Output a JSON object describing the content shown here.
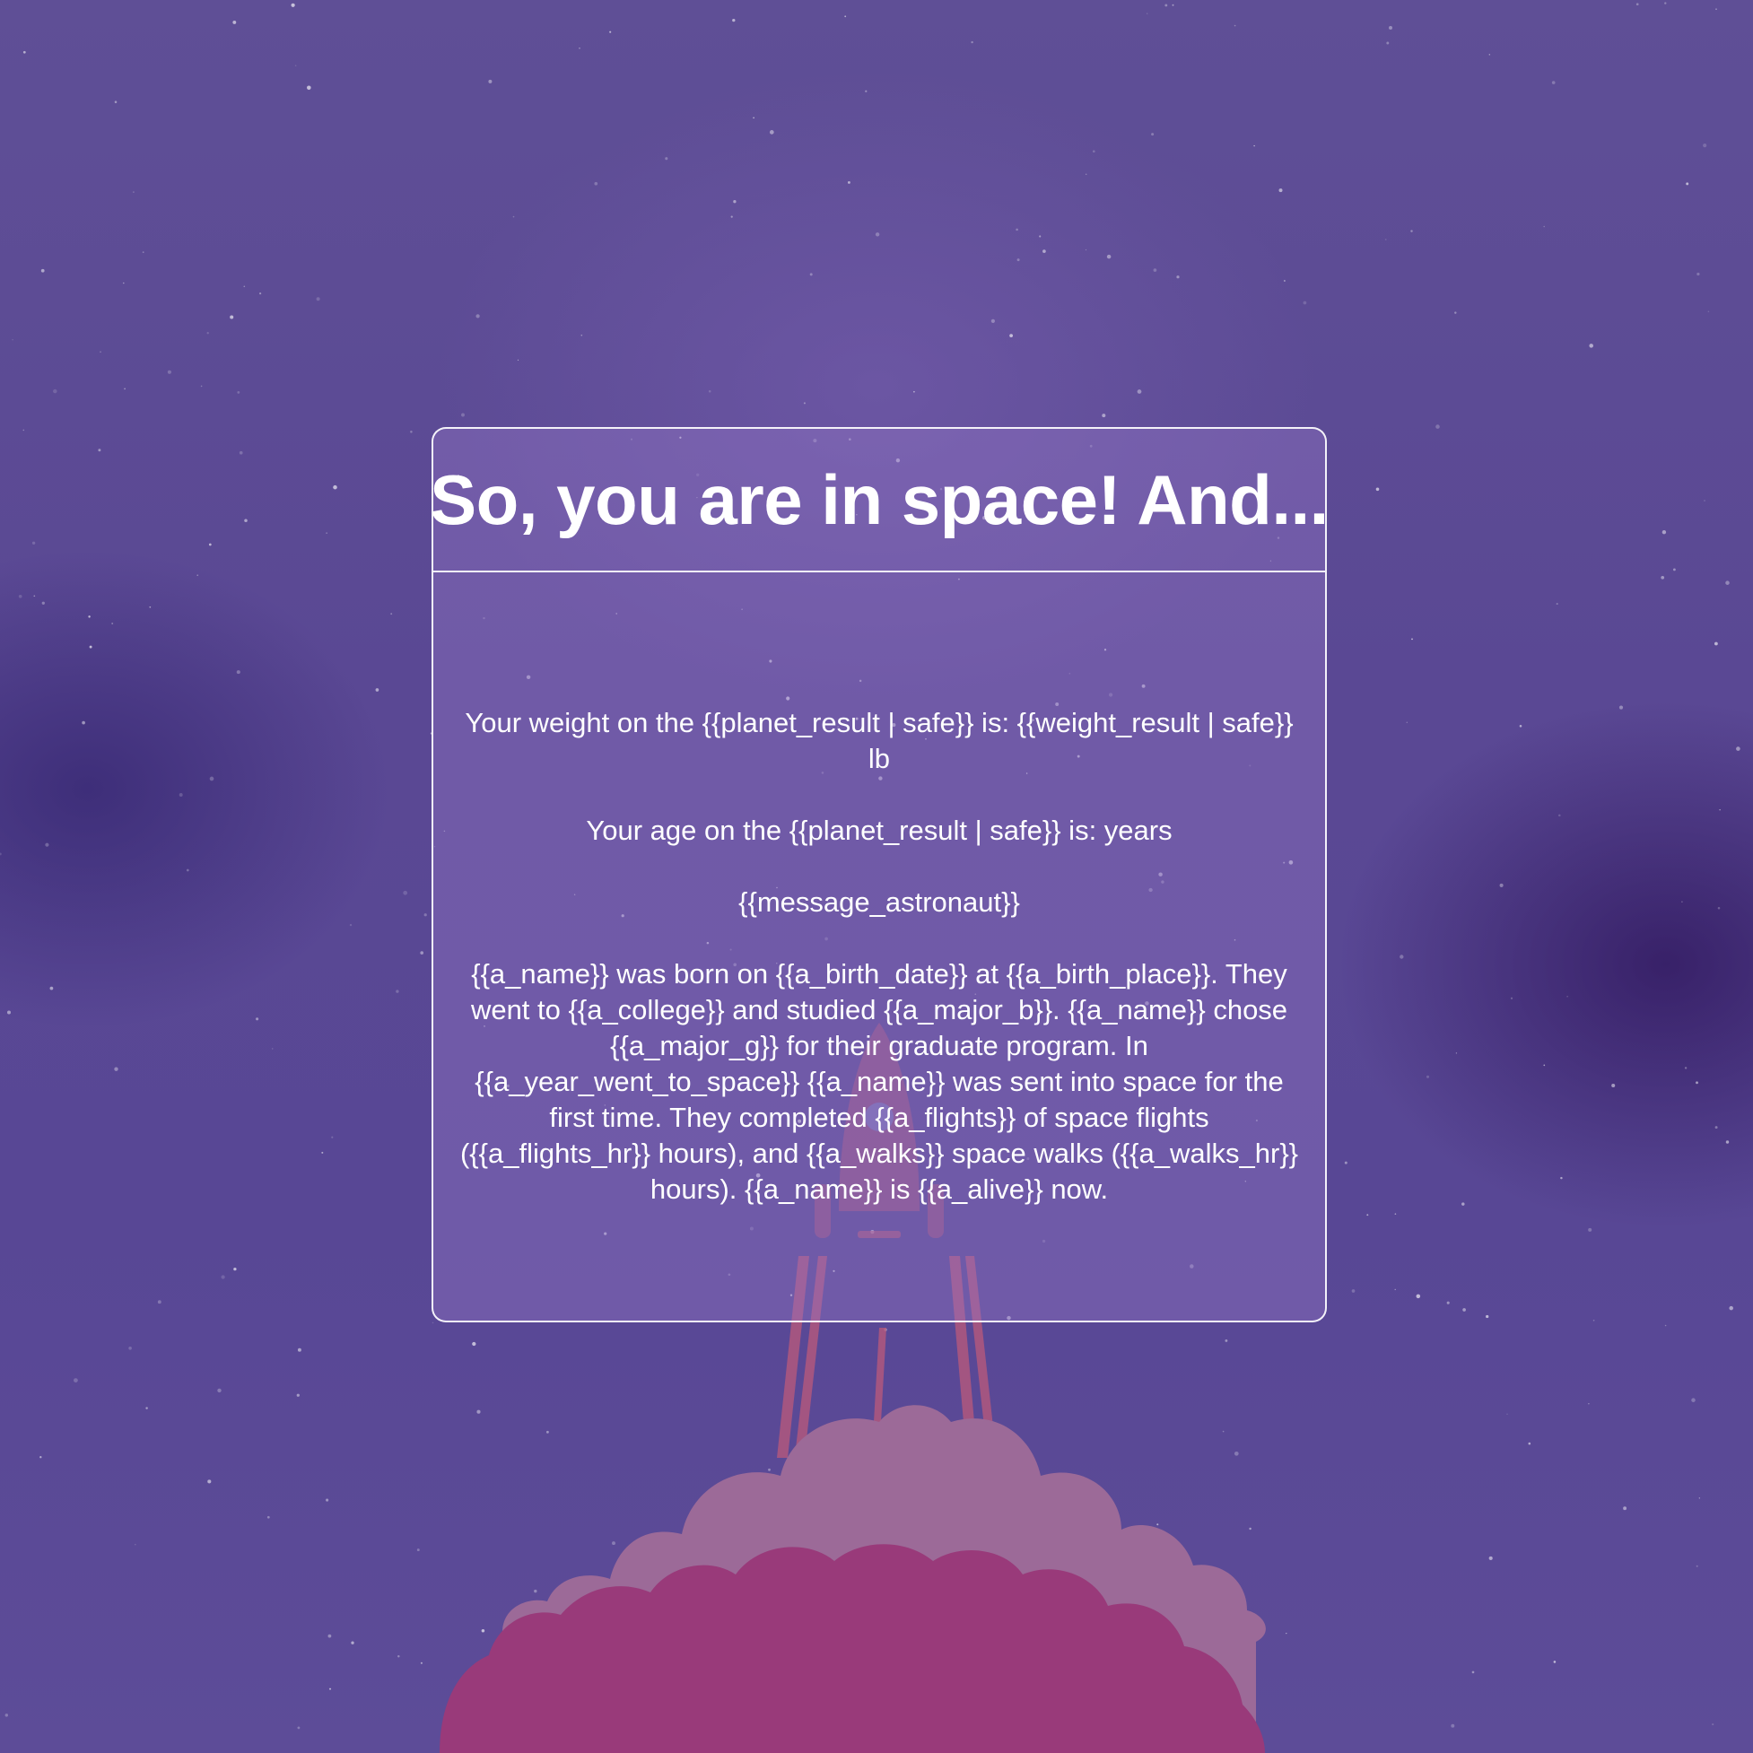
{
  "title": "So, you are in space! And...",
  "results": {
    "weight_line": "Your weight on the {{planet_result | safe}} is: {{weight_result | safe}} lb",
    "age_line": "Your age on the {{planet_result | safe}} is: years",
    "message_line": "{{message_astronaut}}",
    "bio_line": "{{a_name}} was born on {{a_birth_date}} at {{a_birth_place}}. They went to {{a_college}} and studied {{a_major_b}}. {{a_name}} chose {{a_major_g}} for their graduate program. In {{a_year_went_to_space}} {{a_name}} was sent into space for the first time. They completed {{a_flights}} of space flights ({{a_flights_hr}} hours), and {{a_walks}} space walks ({{a_walks_hr}} hours). {{a_name}} is {{a_alive}} now."
  },
  "colors": {
    "background": "#5a4894",
    "card_border": "#ffffff",
    "text": "#ffffff",
    "cloud_back": "#9c6a98",
    "cloud_front": "#993a7a",
    "rocket": "#b0587e",
    "rocket_window": "#6f7fd0"
  },
  "icons": {
    "rocket": "rocket-illustration",
    "cloud": "launch-smoke-cloud",
    "stars": "starfield"
  }
}
